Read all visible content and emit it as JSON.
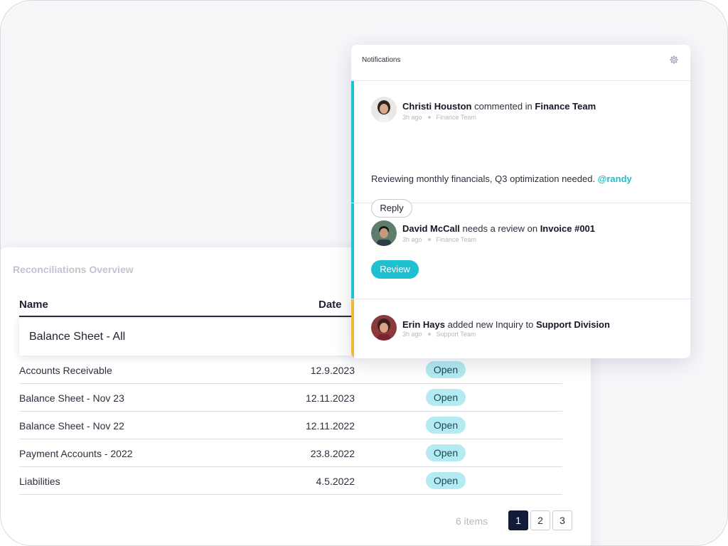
{
  "reconciliations": {
    "title": "Reconciliations Overview",
    "columns": {
      "name": "Name",
      "date": "Date"
    },
    "highlighted_row": "Balance Sheet - All",
    "rows": [
      {
        "name": "Accounts Receivable",
        "date": "12.9.2023",
        "status": "Open"
      },
      {
        "name": "Balance Sheet - Nov 23",
        "date": "12.11.2023",
        "status": "Open"
      },
      {
        "name": "Balance Sheet - Nov 22",
        "date": "12.11.2022",
        "status": "Open"
      },
      {
        "name": "Payment Accounts - 2022",
        "date": "23.8.2022",
        "status": "Open"
      },
      {
        "name": "Liabilities",
        "date": "4.5.2022",
        "status": "Open"
      }
    ],
    "items_count": "6 items",
    "pages": [
      "1",
      "2",
      "3"
    ],
    "active_page": "1"
  },
  "notifications": {
    "title": "Notifications",
    "settings_icon": "gear-icon",
    "items": [
      {
        "user": "Christi Houston",
        "action": "commented in",
        "target": "Finance Team",
        "time": "3h ago",
        "team": "Finance Team",
        "message": "Reviewing monthly financials, Q3 optimization needed.",
        "mention": "@randy",
        "button": "Reply",
        "accent": "#1fc0d0"
      },
      {
        "user": "David McCall",
        "action": "needs a review on",
        "target": "Invoice #001",
        "time": "3h ago",
        "team": "Finance Team",
        "button": "Review",
        "accent": "#1fc0d0"
      },
      {
        "user": "Erin Hays",
        "action": "added new Inquiry to",
        "target": "Support Division",
        "time": "3h ago",
        "team": "Support Team",
        "accent": "#f2b540"
      }
    ]
  },
  "colors": {
    "accent": "#1fc0d0",
    "warning": "#f2b540",
    "status_badge": "#b4eaf1",
    "pagination_active": "#131a3a"
  }
}
